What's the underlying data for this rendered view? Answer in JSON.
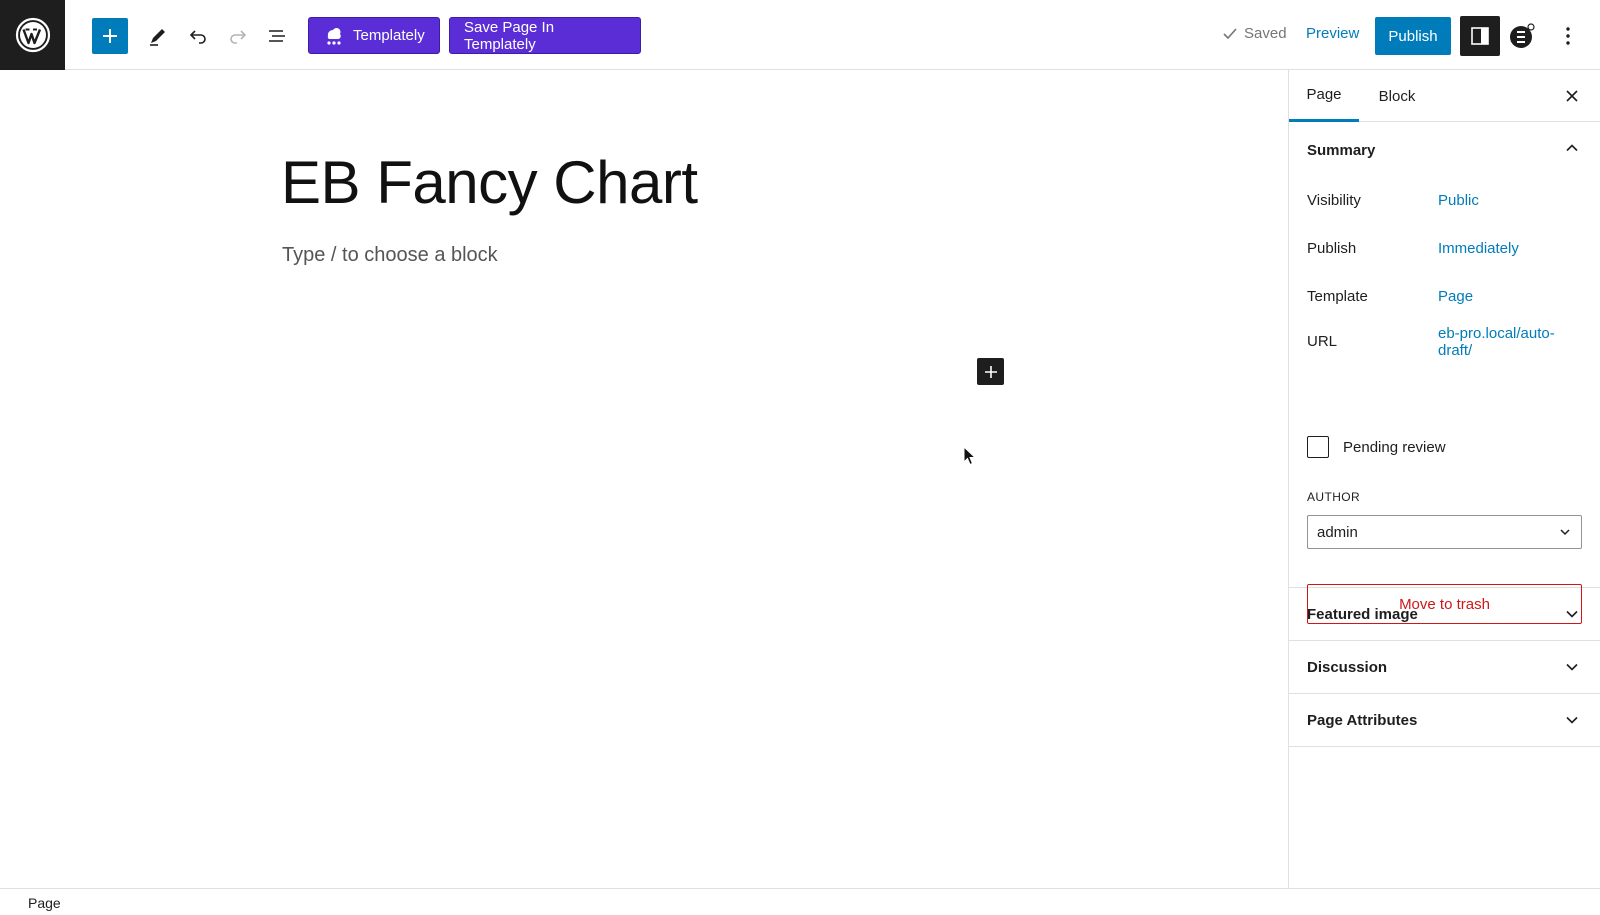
{
  "header": {
    "templately_label": "Templately",
    "save_templately_label": "Save Page In Templately",
    "saved_label": "Saved",
    "preview_label": "Preview",
    "publish_label": "Publish"
  },
  "editor": {
    "title": "EB Fancy Chart",
    "placeholder": "Type / to choose a block"
  },
  "sidebar": {
    "tabs": [
      "Page",
      "Block"
    ],
    "active_tab": "Page",
    "summary": {
      "title": "Summary",
      "rows": [
        {
          "label": "Visibility",
          "value": "Public"
        },
        {
          "label": "Publish",
          "value": "Immediately"
        },
        {
          "label": "Template",
          "value": "Page"
        },
        {
          "label": "URL",
          "value_line1": "eb-pro.local/auto-",
          "value_line2": "draft/"
        }
      ],
      "pending_review_label": "Pending review",
      "pending_review_checked": false,
      "author_label": "AUTHOR",
      "author_value": "admin",
      "trash_label": "Move to trash"
    },
    "panels": [
      "Featured image",
      "Discussion",
      "Page Attributes"
    ]
  },
  "footer": {
    "breadcrumb": "Page"
  },
  "colors": {
    "accent": "#007cba",
    "templately_purple": "#5a2dd6",
    "danger": "#cc1818",
    "dark": "#1e1e1e"
  }
}
